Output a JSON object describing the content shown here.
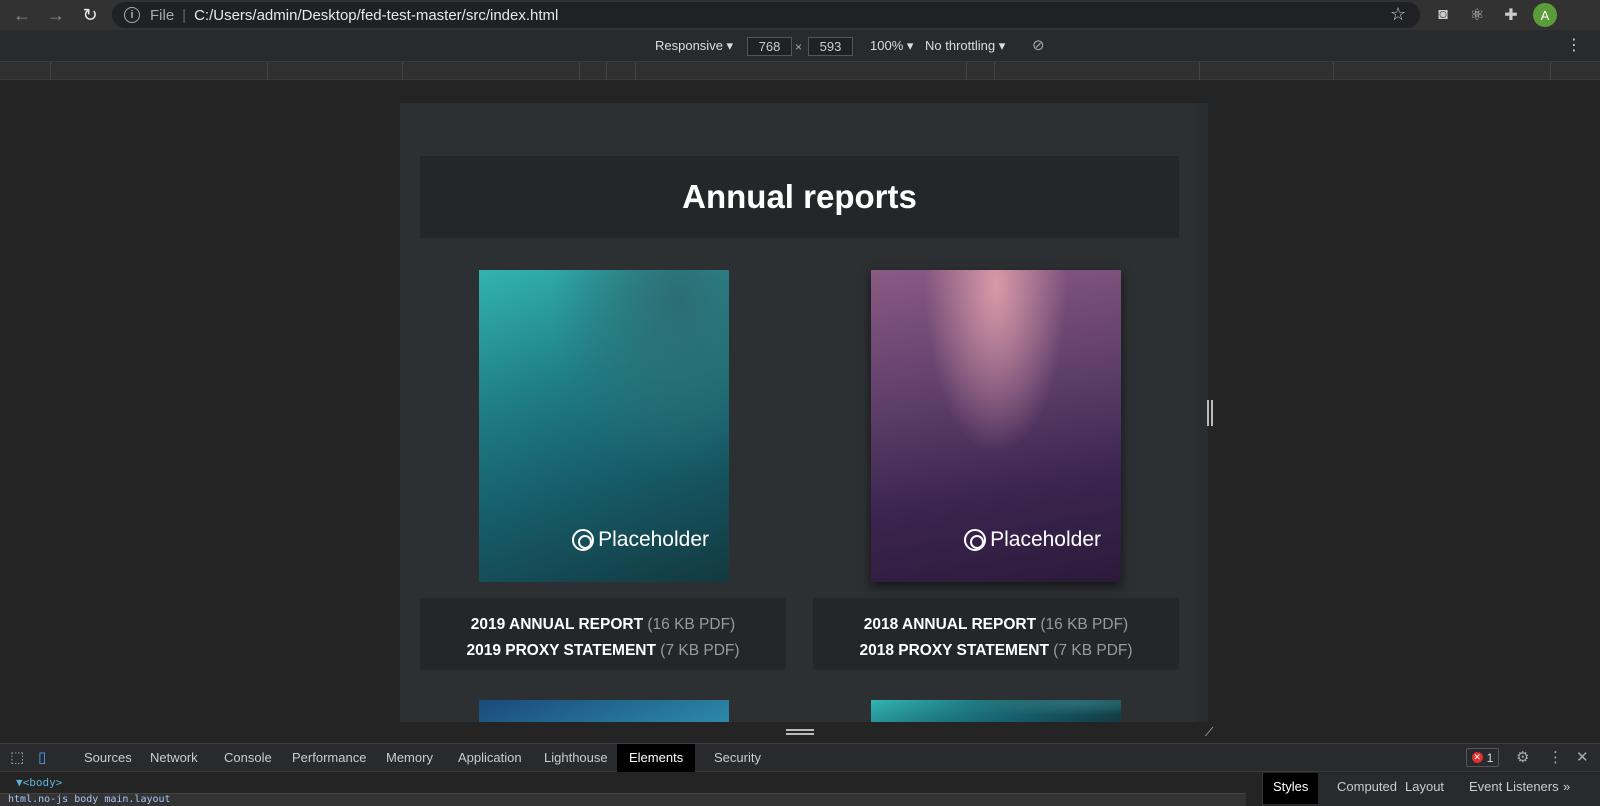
{
  "browser": {
    "back_icon": "arrow-left-icon",
    "forward_icon": "arrow-right-icon",
    "reload_icon": "reload-icon",
    "file_label": "File",
    "url": "C:/Users/admin/Desktop/fed-test-master/src/index.html",
    "avatar_letter": "A"
  },
  "device_toolbar": {
    "device": "Responsive",
    "width": "768",
    "height": "593",
    "times": "×",
    "zoom": "100%",
    "throttling": "No throttling"
  },
  "page": {
    "title": "Annual reports",
    "reports": [
      {
        "cover_brand": "Placeholder",
        "report_title": "2019 ANNUAL REPORT",
        "report_meta": "(16 KB PDF)",
        "proxy_title": "2019 PROXY STATEMENT",
        "proxy_meta": "(7 KB PDF)"
      },
      {
        "cover_brand": "Placeholder",
        "report_title": "2018 ANNUAL REPORT",
        "report_meta": "(16 KB PDF)",
        "proxy_title": "2018 PROXY STATEMENT",
        "proxy_meta": "(7 KB PDF)"
      }
    ]
  },
  "devtools": {
    "tabs": [
      "Sources",
      "Network",
      "Console",
      "Performance",
      "Memory",
      "Application",
      "Lighthouse",
      "Elements",
      "Security"
    ],
    "active_tab": "Elements",
    "error_count": "1",
    "body_tag": "▼<body>",
    "breadcrumb": "html.no-js   body   main.layout",
    "styles_tabs": [
      "Styles",
      "Computed",
      "Layout",
      "Event Listeners"
    ],
    "more_tabs": "»"
  }
}
